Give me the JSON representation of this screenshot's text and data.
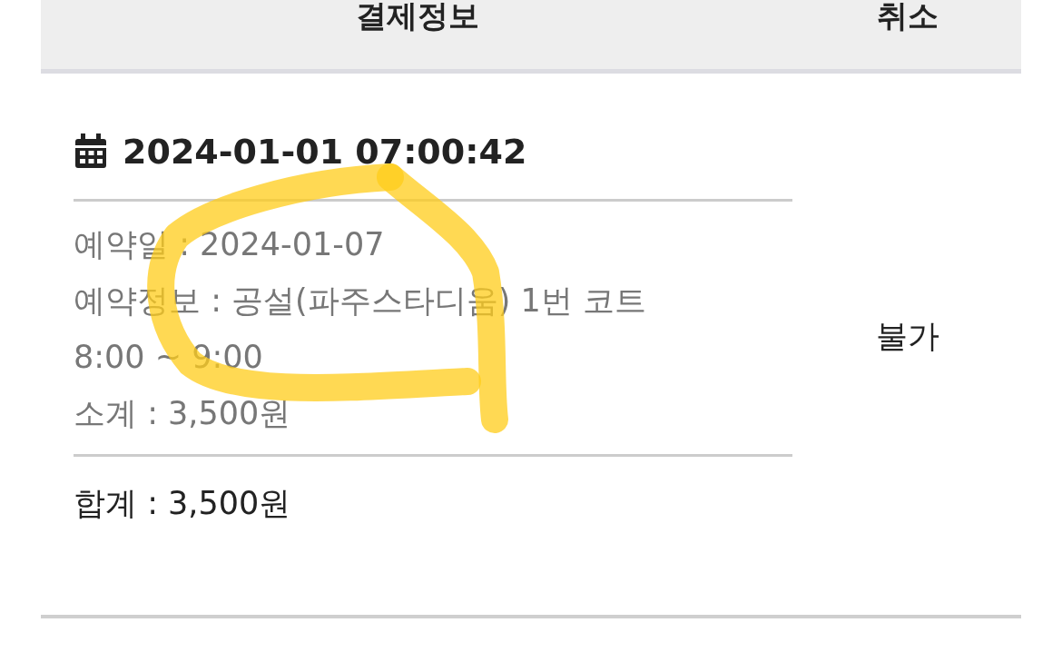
{
  "table": {
    "columns": [
      "결제정보",
      "취소"
    ],
    "rows": [
      {
        "datetime": "2024-01-01 07:00:42",
        "details": [
          "예약일 : 2024-01-07",
          "예약정보 : 공설(파주스타디움) 1번 코트",
          "8:00 ~ 9:00",
          "소계 : 3,500원"
        ],
        "total": "합계 : 3,500원",
        "cancel": "불가"
      }
    ]
  }
}
